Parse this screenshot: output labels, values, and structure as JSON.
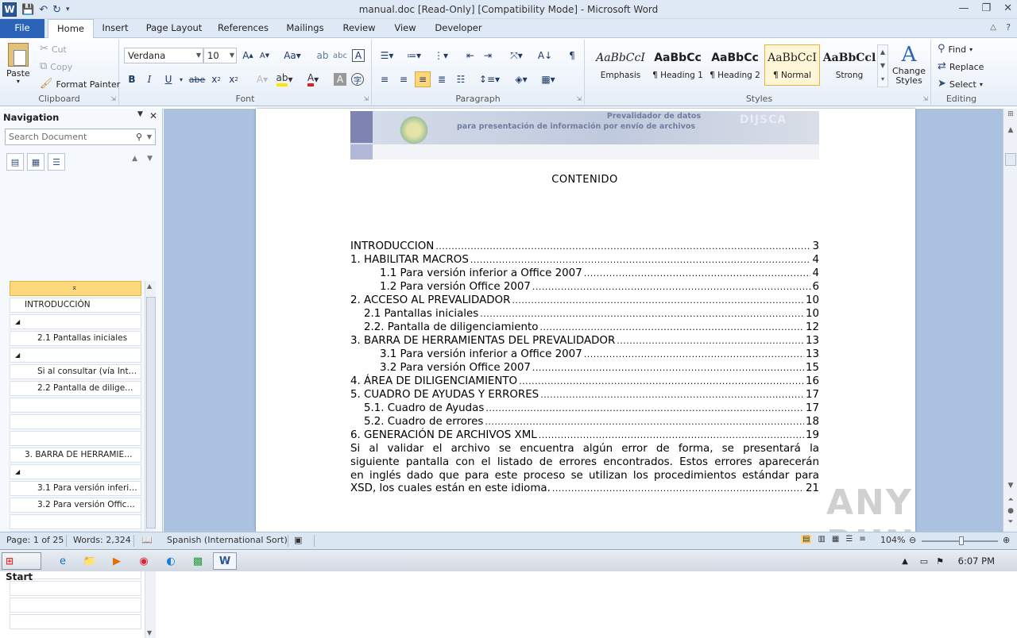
{
  "window": {
    "title": "manual.doc [Read-Only] [Compatibility Mode]  -  Microsoft Word"
  },
  "tabs": [
    "File",
    "Home",
    "Insert",
    "Page Layout",
    "References",
    "Mailings",
    "Review",
    "View",
    "Developer"
  ],
  "ribbon": {
    "clipboard": {
      "paste": "Paste",
      "cut": "Cut",
      "copy": "Copy",
      "format_painter": "Format Painter",
      "label": "Clipboard"
    },
    "font": {
      "name": "Verdana",
      "size": "10",
      "label": "Font"
    },
    "paragraph": {
      "label": "Paragraph"
    },
    "styles": {
      "items": [
        {
          "sample": "AaBbCcI",
          "name": "Emphasis"
        },
        {
          "sample": "AaBbCc",
          "name": "¶ Heading 1"
        },
        {
          "sample": "AaBbCc",
          "name": "¶ Heading 2"
        },
        {
          "sample": "AaBbCcI",
          "name": "¶ Normal"
        },
        {
          "sample": "AaBbCcl",
          "name": "Strong"
        }
      ],
      "change_styles": "Change Styles",
      "label": "Styles"
    },
    "editing": {
      "find": "Find",
      "replace": "Replace",
      "select": "Select",
      "label": "Editing"
    }
  },
  "navigation": {
    "title": "Navigation",
    "search_placeholder": "Search Document",
    "items": [
      {
        "text": "",
        "indent": 0
      },
      {
        "text": "INTRODUCCIÓN",
        "indent": 1
      },
      {
        "text": "◢",
        "indent": 0
      },
      {
        "text": "2.1 Pantallas iniciales",
        "indent": 2
      },
      {
        "text": "◢",
        "indent": 0
      },
      {
        "text": "Si al consultar (vía Inter…",
        "indent": 2
      },
      {
        "text": "2.2 Pantalla de diligenc…",
        "indent": 2
      },
      {
        "text": "",
        "indent": 0
      },
      {
        "text": "",
        "indent": 0
      },
      {
        "text": "",
        "indent": 0
      },
      {
        "text": "3. BARRA DE HERRAMIENT…",
        "indent": 1
      },
      {
        "text": "◢",
        "indent": 0
      },
      {
        "text": "3.1 Para versión inferio…",
        "indent": 2
      },
      {
        "text": "3.2 Para versión Office …",
        "indent": 2
      },
      {
        "text": "",
        "indent": 0
      },
      {
        "text": "",
        "indent": 0
      },
      {
        "text": "",
        "indent": 0
      },
      {
        "text": "",
        "indent": 0
      },
      {
        "text": "",
        "indent": 0
      },
      {
        "text": "",
        "indent": 0
      },
      {
        "text": "",
        "indent": 0
      }
    ]
  },
  "document": {
    "banner": {
      "line1": "Prevalidador de datos",
      "line2": "para presentación de información por envío de archivos",
      "logo": "DIJSCA"
    },
    "heading": "CONTENIDO",
    "toc": [
      {
        "label": "INTRODUCCION",
        "page": "3",
        "indent": 0
      },
      {
        "label": "1. HABILITAR MACROS",
        "page": "4",
        "indent": 0
      },
      {
        "label": "1.1 Para versión inferior a Office 2007",
        "page": "4",
        "indent": 2
      },
      {
        "label": "1.2 Para versión Office 2007",
        "page": "6",
        "indent": 2
      },
      {
        "label": "2. ACCESO AL PREVALIDADOR",
        "page": "10",
        "indent": 0
      },
      {
        "label": "2.1  Pantallas iniciales",
        "page": "10",
        "indent": 1
      },
      {
        "label": "2.2. Pantalla de diligenciamiento",
        "page": "12",
        "indent": 1
      },
      {
        "label": "3. BARRA DE HERRAMIENTAS DEL PREVALIDADOR",
        "page": "13",
        "indent": 0
      },
      {
        "label": "3.1  Para versión inferior a Office 2007",
        "page": "13",
        "indent": 2
      },
      {
        "label": "3.2  Para versión Office 2007",
        "page": "15",
        "indent": 2
      },
      {
        "label": "4. ÁREA DE DILIGENCIAMIENTO",
        "page": "16",
        "indent": 0
      },
      {
        "label": "5. CUADRO DE AYUDAS Y ERRORES",
        "page": "17",
        "indent": 0
      },
      {
        "label": "5.1. Cuadro de Ayudas",
        "page": "17",
        "indent": 1
      },
      {
        "label": "5.2. Cuadro de errores",
        "page": "18",
        "indent": 1
      },
      {
        "label": "6. GENERACIÓN DE ARCHIVOS XML",
        "page": "19",
        "indent": 0
      }
    ],
    "paragraph_lines": [
      "Si al validar el archivo se encuentra algún error de forma, se presentará la",
      "siguiente pantalla con el listado de errores encontrados.  Estos errores aparecerán",
      "en inglés dado que para este proceso se utilizan los procedimientos estándar para"
    ],
    "paragraph_last": {
      "label": "XSD, los cuales están en este idioma.",
      "page": "21"
    }
  },
  "status": {
    "page": "Page: 1 of 25",
    "words": "Words: 2,324",
    "language": "Spanish (International Sort)",
    "zoom": "104%",
    "zoom_level": 0.52
  },
  "taskbar": {
    "start": "Start",
    "time": "6:07 PM"
  },
  "watermark": "ANY RUN"
}
